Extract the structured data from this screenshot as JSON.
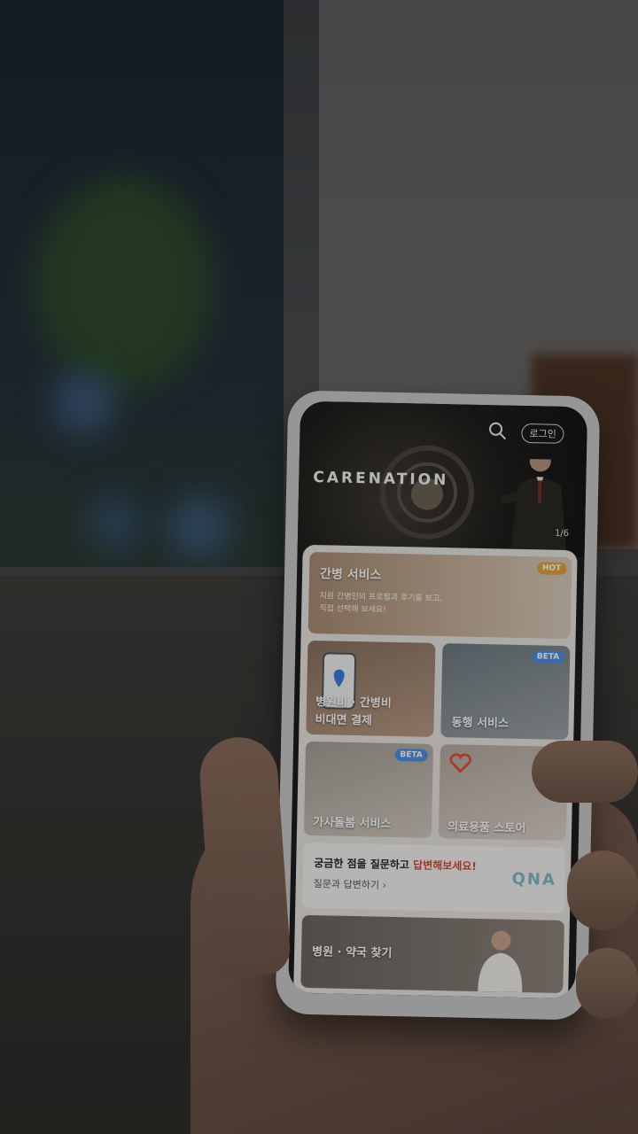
{
  "app": {
    "brand": "CARENATION",
    "login_label": "로그인",
    "slide_counter": "1/6"
  },
  "services": {
    "care": {
      "title": "간병 서비스",
      "desc_line1": "지원 간병인의 프로필과 후기를 보고,",
      "desc_line2": "직접 선택해 보세요!",
      "badge": "HOT"
    },
    "payment": {
      "title_line1": "병원비 · 간병비",
      "title_line2": "비대면 결제"
    },
    "companion": {
      "title": "동행 서비스",
      "badge": "BETA"
    },
    "housekeeping": {
      "title": "가사돌봄 서비스",
      "badge": "BETA"
    },
    "store": {
      "title": "의료용품 스토어"
    }
  },
  "qa": {
    "question_prefix": "궁금한 점을 질문하고 ",
    "question_highlight": "답변해보세요!",
    "answer_link": "질문과 답변하기 ›",
    "graphic_text": "QNA"
  },
  "find": {
    "title": "병원 · 약국 찾기"
  },
  "colors": {
    "hot": "#e0a33a",
    "beta": "#4e8fe0",
    "highlight": "#d9463e"
  },
  "icons": {
    "search": "search-icon"
  }
}
